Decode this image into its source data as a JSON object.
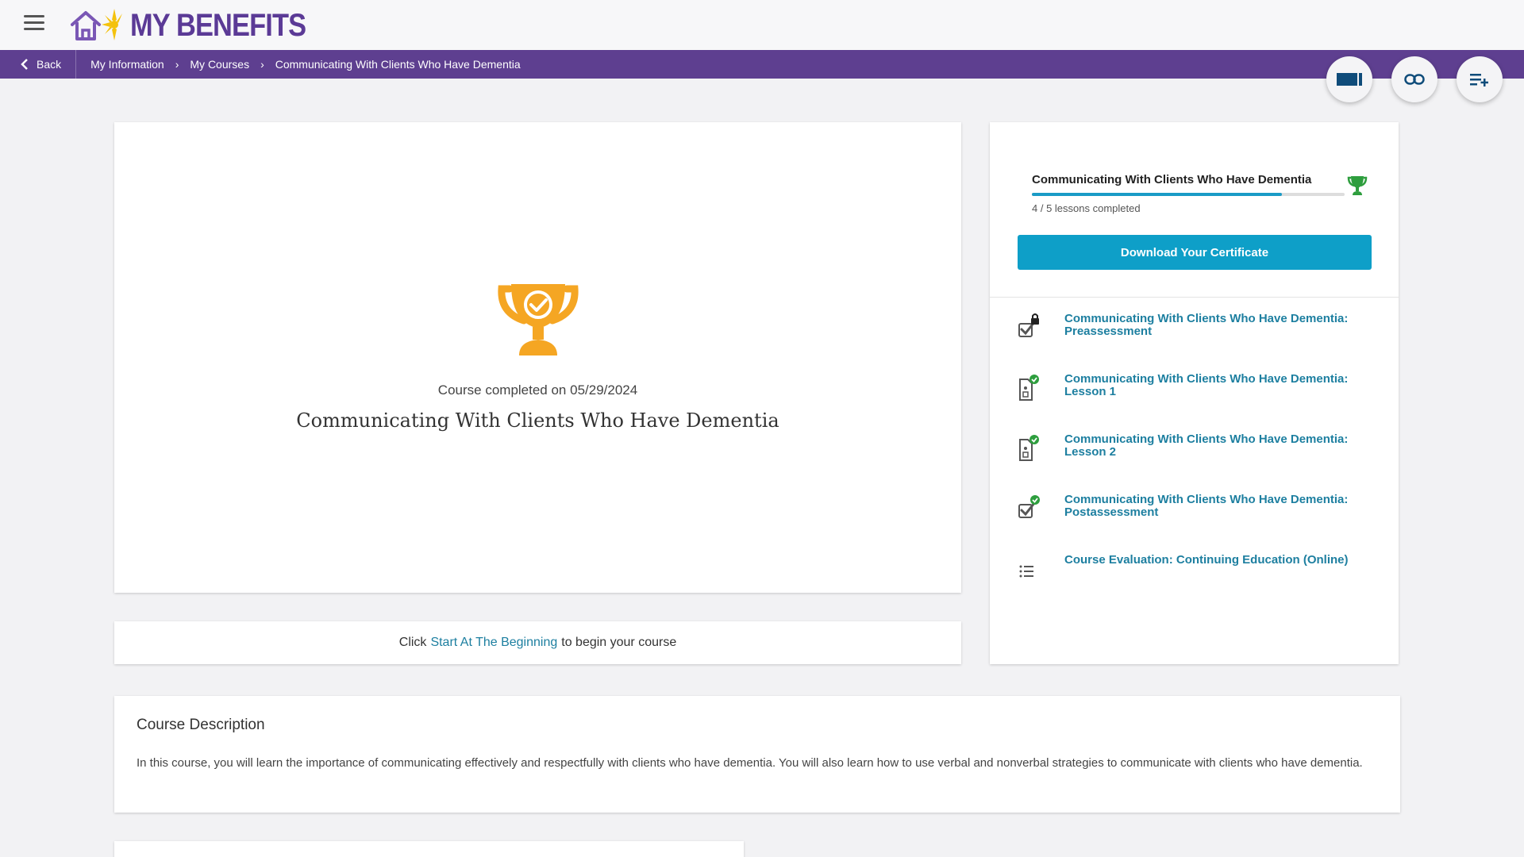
{
  "app": {
    "logo_text": "MY BENEFITS"
  },
  "breadcrumb": {
    "back_label": "Back",
    "items": [
      "My Information",
      "My Courses",
      "Communicating With Clients Who Have Dementia"
    ]
  },
  "hero": {
    "completed_text": "Course completed on 05/29/2024",
    "title": "Communicating With Clients Who Have Dementia"
  },
  "start": {
    "prefix": "Click",
    "link": "Start At The Beginning",
    "suffix": "to begin your course"
  },
  "side": {
    "title": "Communicating With Clients Who Have Dementia",
    "progress": 0.8,
    "lessons_count": "4 / 5 lessons completed",
    "certificate_button": "Download Your Certificate",
    "lessons": [
      {
        "label": "Communicating With Clients Who Have Dementia: Preassessment",
        "icon": "checkbox-locked-icon"
      },
      {
        "label": "Communicating With Clients Who Have Dementia: Lesson 1",
        "icon": "document-complete-icon"
      },
      {
        "label": "Communicating With Clients Who Have Dementia: Lesson 2",
        "icon": "document-complete-icon"
      },
      {
        "label": "Communicating With Clients Who Have Dementia: Postassessment",
        "icon": "checkbox-complete-icon"
      },
      {
        "label": "Course Evaluation: Continuing Education (Online)",
        "icon": "list-icon"
      }
    ]
  },
  "description": {
    "title": "Course Description",
    "body": "In this course, you will learn the importance of communicating effectively and respectfully with clients who have dementia. You will also learn how to use verbal and nonverbal strategies to communicate with clients who have dementia."
  },
  "colors": {
    "brand_purple": "#5e3f90",
    "accent_blue": "#0e9fc8",
    "link_blue": "#1d7fa0",
    "trophy_orange": "#f5a623",
    "success_green": "#2e9e3e"
  }
}
